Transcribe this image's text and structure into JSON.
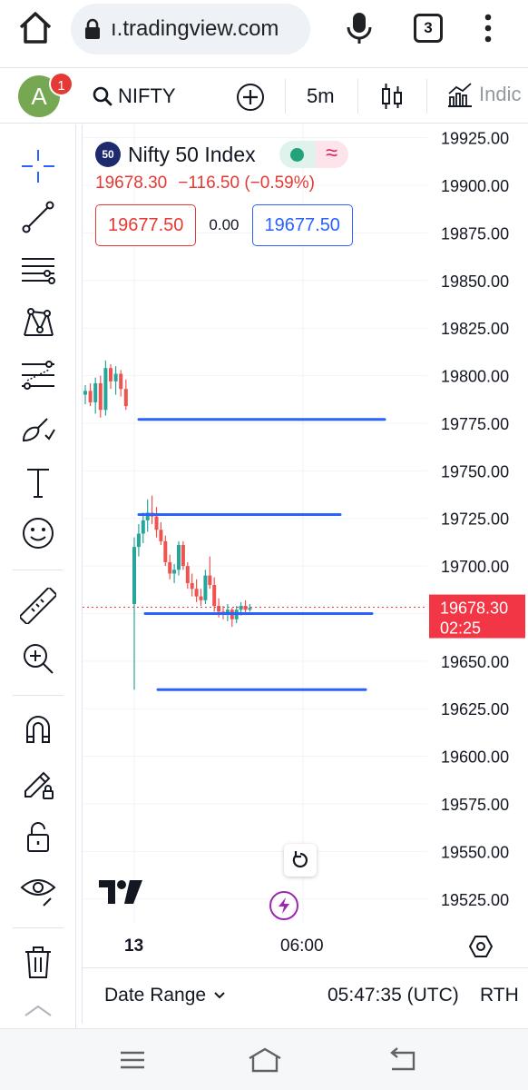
{
  "browser": {
    "url": "ı.tradingview.com",
    "tab_count": "3"
  },
  "toolbar": {
    "avatar_letter": "A",
    "notification_count": "1",
    "symbol": "NIFTY",
    "interval": "5m",
    "indicators_label": "Indic"
  },
  "legend": {
    "badge": "50",
    "name": "Nifty 50 Index",
    "price": "19678.30",
    "change": "−116.50 (−0.59%)",
    "sell_price": "19677.50",
    "spread": "0.00",
    "buy_price": "19677.50"
  },
  "chart_data": {
    "type": "candlestick",
    "y_axis_ticks": [
      "19925.00",
      "19900.00",
      "19875.00",
      "19850.00",
      "19825.00",
      "19800.00",
      "19775.00",
      "19750.00",
      "19725.00",
      "19700.00",
      "19675.00",
      "19650.00",
      "19625.00",
      "19600.00",
      "19575.00",
      "19550.00",
      "19525.00"
    ],
    "x_axis_ticks": [
      "13",
      "06:00"
    ],
    "current_price": "19678.30",
    "countdown": "02:25",
    "ylim": [
      19512,
      19932
    ],
    "colors": {
      "up": "#26a69a",
      "down": "#ef5350",
      "hline": "#2962ff",
      "price_label": "#f23645"
    },
    "horizontal_lines": [
      19777,
      19727,
      19675,
      19635
    ],
    "candles": [
      {
        "o": 19790,
        "h": 19795,
        "l": 19785,
        "c": 19792
      },
      {
        "o": 19792,
        "h": 19796,
        "l": 19784,
        "c": 19786
      },
      {
        "o": 19786,
        "h": 19799,
        "l": 19780,
        "c": 19796
      },
      {
        "o": 19796,
        "h": 19800,
        "l": 19778,
        "c": 19782
      },
      {
        "o": 19782,
        "h": 19808,
        "l": 19779,
        "c": 19804
      },
      {
        "o": 19804,
        "h": 19806,
        "l": 19793,
        "c": 19797
      },
      {
        "o": 19797,
        "h": 19805,
        "l": 19790,
        "c": 19801
      },
      {
        "o": 19801,
        "h": 19803,
        "l": 19789,
        "c": 19793
      },
      {
        "o": 19793,
        "h": 19798,
        "l": 19782,
        "c": 19784
      },
      {
        "o": 19680,
        "h": 19715,
        "l": 19635,
        "c": 19710
      },
      {
        "o": 19710,
        "h": 19722,
        "l": 19705,
        "c": 19717
      },
      {
        "o": 19717,
        "h": 19728,
        "l": 19712,
        "c": 19724
      },
      {
        "o": 19724,
        "h": 19735,
        "l": 19718,
        "c": 19728
      },
      {
        "o": 19728,
        "h": 19737,
        "l": 19722,
        "c": 19726
      },
      {
        "o": 19726,
        "h": 19731,
        "l": 19715,
        "c": 19719
      },
      {
        "o": 19719,
        "h": 19723,
        "l": 19711,
        "c": 19713
      },
      {
        "o": 19713,
        "h": 19716,
        "l": 19700,
        "c": 19702
      },
      {
        "o": 19702,
        "h": 19706,
        "l": 19693,
        "c": 19696
      },
      {
        "o": 19696,
        "h": 19701,
        "l": 19691,
        "c": 19698
      },
      {
        "o": 19698,
        "h": 19713,
        "l": 19695,
        "c": 19711
      },
      {
        "o": 19711,
        "h": 19713,
        "l": 19698,
        "c": 19700
      },
      {
        "o": 19700,
        "h": 19702,
        "l": 19688,
        "c": 19691
      },
      {
        "o": 19691,
        "h": 19696,
        "l": 19684,
        "c": 19688
      },
      {
        "o": 19688,
        "h": 19693,
        "l": 19681,
        "c": 19684
      },
      {
        "o": 19684,
        "h": 19688,
        "l": 19679,
        "c": 19682
      },
      {
        "o": 19682,
        "h": 19698,
        "l": 19680,
        "c": 19695
      },
      {
        "o": 19695,
        "h": 19705,
        "l": 19688,
        "c": 19690
      },
      {
        "o": 19690,
        "h": 19694,
        "l": 19676,
        "c": 19679
      },
      {
        "o": 19679,
        "h": 19683,
        "l": 19673,
        "c": 19676
      },
      {
        "o": 19676,
        "h": 19679,
        "l": 19672,
        "c": 19675
      },
      {
        "o": 19675,
        "h": 19680,
        "l": 19671,
        "c": 19677
      },
      {
        "o": 19677,
        "h": 19678,
        "l": 19668,
        "c": 19672
      },
      {
        "o": 19672,
        "h": 19679,
        "l": 19670,
        "c": 19677
      },
      {
        "o": 19677,
        "h": 19681,
        "l": 19674,
        "c": 19679
      },
      {
        "o": 19679,
        "h": 19682,
        "l": 19675,
        "c": 19677
      },
      {
        "o": 19677,
        "h": 19680,
        "l": 19676,
        "c": 19678
      }
    ]
  },
  "bottom": {
    "date_range": "Date Range",
    "clock": "05:47:35 (UTC)",
    "session": "RTH"
  }
}
